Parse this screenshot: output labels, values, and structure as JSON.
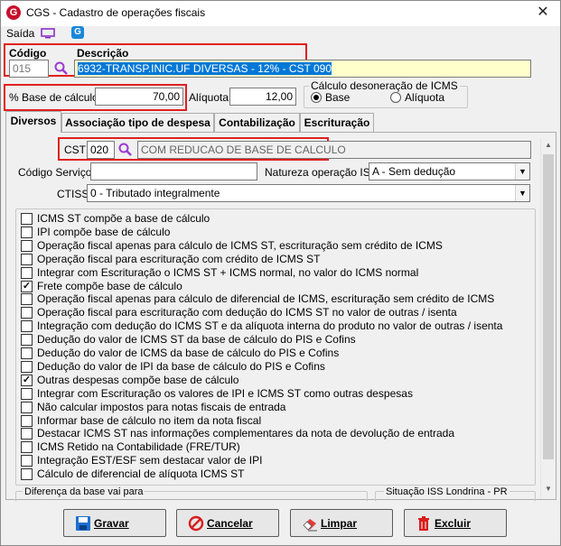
{
  "window": {
    "title": "CGS - Cadastro de operações fiscais",
    "close": "✕"
  },
  "menu": {
    "saida": "Saída"
  },
  "codigo": {
    "label": "Código",
    "value": "015"
  },
  "descricao": {
    "label": "Descrição",
    "value": "6932-TRANSP.INIC.UF DIVERSAS - 12% - CST 090"
  },
  "base_calculo": {
    "label": "% Base de cálculo",
    "value": "70,00"
  },
  "aliquota": {
    "label": "Alíquota",
    "value": "12,00"
  },
  "desoneracao": {
    "title": "Cálculo desoneração de ICMS",
    "options": [
      "Base",
      "Alíquota"
    ],
    "selected": "Base"
  },
  "tabs": [
    "Diversos",
    "Associação tipo de despesa",
    "Contabilização",
    "Escrituração"
  ],
  "active_tab": "Diversos",
  "cst": {
    "label": "CST",
    "value": "020",
    "description": "COM REDUCAO DE BASE DE CALCULO"
  },
  "codigo_servico": {
    "label": "Código Serviço",
    "value": ""
  },
  "natureza_iss": {
    "label": "Natureza operação ISS",
    "value": "A - Sem dedução"
  },
  "ctiss": {
    "label": "CTISS",
    "value": "0 - Tributado integralmente"
  },
  "checkboxes": [
    {
      "label": "ICMS ST compõe a base de cálculo",
      "checked": false
    },
    {
      "label": "IPI compõe base de cálculo",
      "checked": false
    },
    {
      "label": "Operação fiscal apenas para cálculo de ICMS ST, escrituração sem crédito de ICMS",
      "checked": false
    },
    {
      "label": "Operação fiscal para escrituração com crédito de ICMS ST",
      "checked": false
    },
    {
      "label": "Integrar com Escrituração o ICMS ST + ICMS normal,  no valor do ICMS normal",
      "checked": false
    },
    {
      "label": "Frete compõe base de cálculo",
      "checked": true
    },
    {
      "label": "Operação fiscal apenas para cálculo de diferencial de ICMS, escrituração sem crédito de ICMS",
      "checked": false
    },
    {
      "label": "Operação fiscal para escrituração com dedução do ICMS ST no valor de outras / isenta",
      "checked": false
    },
    {
      "label": "Integração com dedução do ICMS ST e da alíquota interna do produto no valor de outras / isenta",
      "checked": false
    },
    {
      "label": "Dedução do valor de ICMS ST da base de cálculo do PIS e Cofins",
      "checked": false
    },
    {
      "label": "Dedução do valor de ICMS da base de cálculo do PIS e Cofins",
      "checked": false
    },
    {
      "label": "Dedução do valor de IPI da base de cálculo do PIS e Cofins",
      "checked": false
    },
    {
      "label": "Outras despesas compõe base de cálculo",
      "checked": true
    },
    {
      "label": "Integrar com Escrituração os valores de IPI e ICMS ST como outras despesas",
      "checked": false
    },
    {
      "label": "Não calcular impostos para notas fiscais de entrada",
      "checked": false
    },
    {
      "label": "Informar base de cálculo no item da nota fiscal",
      "checked": false
    },
    {
      "label": "Destacar ICMS ST nas informações complementares da nota de devolução de entrada",
      "checked": false
    },
    {
      "label": "ICMS Retido na Contabilidade (FRE/TUR)",
      "checked": false
    },
    {
      "label": "Integração EST/ESF sem destacar valor de IPI",
      "checked": false
    },
    {
      "label": "Cálculo de diferencial de alíquota ICMS ST",
      "checked": false
    }
  ],
  "bottom_groups": {
    "left": "Diferença da base vai para",
    "right": "Situação ISS Londrina - PR"
  },
  "buttons": {
    "gravar": "Gravar",
    "cancelar": "Cancelar",
    "limpar": "Limpar",
    "excluir": "Excluir"
  }
}
